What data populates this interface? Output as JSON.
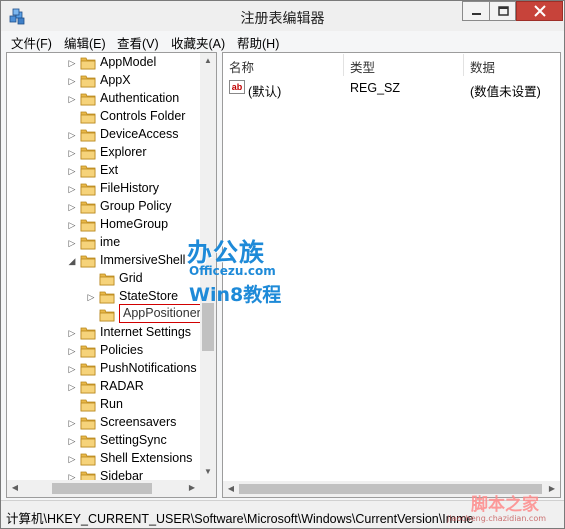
{
  "window": {
    "title": "注册表编辑器"
  },
  "menu": [
    "文件(F)",
    "编辑(E)",
    "查看(V)",
    "收藏夹(A)",
    "帮助(H)"
  ],
  "tree": {
    "items": [
      {
        "label": "AppModel",
        "level": 0,
        "toggle": "collapsed"
      },
      {
        "label": "AppX",
        "level": 0,
        "toggle": "collapsed"
      },
      {
        "label": "Authentication",
        "level": 0,
        "toggle": "collapsed"
      },
      {
        "label": "Controls Folder",
        "level": 0,
        "toggle": "none"
      },
      {
        "label": "DeviceAccess",
        "level": 0,
        "toggle": "collapsed"
      },
      {
        "label": "Explorer",
        "level": 0,
        "toggle": "collapsed"
      },
      {
        "label": "Ext",
        "level": 0,
        "toggle": "collapsed"
      },
      {
        "label": "FileHistory",
        "level": 0,
        "toggle": "collapsed"
      },
      {
        "label": "Group Policy",
        "level": 0,
        "toggle": "collapsed"
      },
      {
        "label": "HomeGroup",
        "level": 0,
        "toggle": "collapsed"
      },
      {
        "label": "ime",
        "level": 0,
        "toggle": "collapsed"
      },
      {
        "label": "ImmersiveShell",
        "level": 0,
        "toggle": "expanded"
      },
      {
        "label": "Grid",
        "level": 1,
        "toggle": "none"
      },
      {
        "label": "StateStore",
        "level": 1,
        "toggle": "collapsed"
      },
      {
        "label": "AppPositioner",
        "level": 1,
        "toggle": "none",
        "selected": true
      },
      {
        "label": "Internet Settings",
        "level": 0,
        "toggle": "collapsed"
      },
      {
        "label": "Policies",
        "level": 0,
        "toggle": "collapsed"
      },
      {
        "label": "PushNotifications",
        "level": 0,
        "toggle": "collapsed"
      },
      {
        "label": "RADAR",
        "level": 0,
        "toggle": "collapsed"
      },
      {
        "label": "Run",
        "level": 0,
        "toggle": "none"
      },
      {
        "label": "Screensavers",
        "level": 0,
        "toggle": "collapsed"
      },
      {
        "label": "SettingSync",
        "level": 0,
        "toggle": "collapsed"
      },
      {
        "label": "Shell Extensions",
        "level": 0,
        "toggle": "collapsed"
      },
      {
        "label": "Sidebar",
        "level": 0,
        "toggle": "collapsed"
      }
    ]
  },
  "list": {
    "headers": {
      "name": "名称",
      "type": "类型",
      "data": "数据"
    },
    "rows": [
      {
        "icon": "ab",
        "name": "(默认)",
        "type": "REG_SZ",
        "data": "(数值未设置)"
      }
    ]
  },
  "status": {
    "path": "计算机\\HKEY_CURRENT_USER\\Software\\Microsoft\\Windows\\CurrentVersion\\Imme"
  },
  "watermark": {
    "brand": "办公族",
    "domain": "Officezu.com",
    "win8": "Win8教程",
    "corner_cn": "脚本之家",
    "corner_url": "jiaocheng.chazidian.com"
  },
  "colors": {
    "selection_border": "#d00000",
    "close_button": "#c7433a",
    "folder": "#e8b84a",
    "watermark_blue": "#1e8ad8"
  }
}
